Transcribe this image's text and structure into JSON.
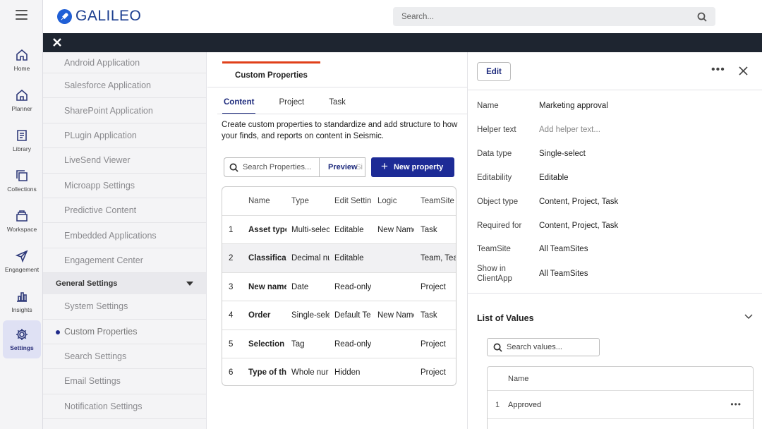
{
  "rail": {
    "items": [
      {
        "label": "Home",
        "icon": "home-icon"
      },
      {
        "label": "Planner",
        "icon": "planner-icon"
      },
      {
        "label": "Library",
        "icon": "library-icon"
      },
      {
        "label": "Collections",
        "icon": "collections-icon"
      },
      {
        "label": "Workspace",
        "icon": "workspace-icon"
      },
      {
        "label": "Engagement",
        "icon": "paper-plane-icon"
      },
      {
        "label": "Insights",
        "icon": "bar-chart-icon"
      },
      {
        "label": "Settings",
        "icon": "gear-icon",
        "active": true
      }
    ]
  },
  "header": {
    "brand": "GALILEO",
    "search_placeholder": "Search..."
  },
  "settings_list": {
    "items_top": [
      "Android Application",
      "Salesforce Application",
      "SharePoint Application",
      "PLugin Application",
      "LiveSend Viewer",
      "Microapp Settings",
      "Predictive Content",
      "Embedded Applications",
      "Engagement Center"
    ],
    "group_label": "General Settings",
    "items_group": [
      "System Settings",
      "Custom Properties",
      "Search Settings",
      "Email Settings",
      "Notification Settings"
    ],
    "current": "Custom Properties"
  },
  "main": {
    "page_tab": "Custom Properties",
    "subtabs": [
      "Content",
      "Project",
      "Task"
    ],
    "active_subtab": "Content",
    "description": "Create custom properties to standardize and add structure to how your finds, and reports on content in Seismic.",
    "search_placeholder": "Search Properties...",
    "preview_label": "Preview",
    "ghost_text": "Si",
    "new_property_label": "New property",
    "table": {
      "headers": [
        "",
        "Name",
        "Type",
        "Edit Settin",
        "Logic",
        "TeamSite"
      ],
      "rows": [
        [
          "1",
          "Asset type",
          "Multi-selec",
          "Editable",
          "New Name",
          "Task"
        ],
        [
          "2",
          "Classificat",
          "Decimal nu",
          "Editable",
          "",
          "Team, Tea"
        ],
        [
          "3",
          "New name",
          "Date",
          "Read-only",
          "",
          "Project"
        ],
        [
          "4",
          "Order",
          "Single-sele",
          "Default Te:",
          "New Name",
          "Task"
        ],
        [
          "5",
          "Selection",
          "Tag",
          "Read-only",
          "",
          "Project"
        ],
        [
          "6",
          "Type of th",
          "Whole nur",
          "Hidden",
          "",
          "Project"
        ]
      ]
    }
  },
  "detail": {
    "edit_label": "Edit",
    "more_label": "•••",
    "properties": [
      {
        "key": "Name",
        "value": "Marketing approval"
      },
      {
        "key": "Helper text",
        "value": "Add helper text...",
        "placeholder": true
      },
      {
        "key": "Data type",
        "value": "Single-select"
      },
      {
        "key": "Editability",
        "value": "Editable"
      },
      {
        "key": "Object type",
        "value": "Content, Project, Task"
      },
      {
        "key": "Required for",
        "value": "Content, Project, Task"
      },
      {
        "key": "TeamSite",
        "value": "All TeamSites"
      },
      {
        "key": "Show in ClientApp",
        "value": "All TeamSites"
      }
    ],
    "list_of_values_title": "List of Values",
    "values_search_placeholder": "Search values...",
    "values_table": {
      "header": "Name",
      "rows": [
        {
          "n": "1",
          "name": "Approved"
        }
      ]
    },
    "row_more_label": "•••"
  },
  "colors": {
    "accent": "#1d2b96",
    "tab_indicator": "#e0401a",
    "dark_bar": "#1e2530"
  }
}
